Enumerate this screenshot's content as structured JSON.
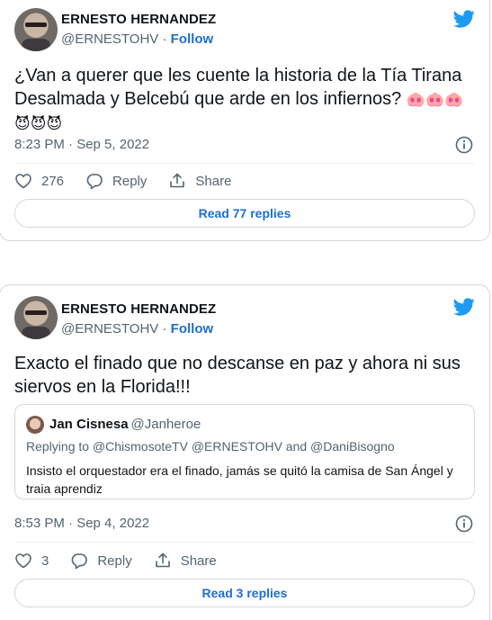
{
  "tweets": [
    {
      "author": {
        "name": "ERNESTO HERNANDEZ",
        "handle": "@ERNESTOHV",
        "separator": "·",
        "follow": "Follow"
      },
      "text": "¿Van a querer que les cuente la historia de la Tía Tirana Desalmada y Belcebú que arde en los infiernos?",
      "emojis": "🐽🐽🐽 😈😈😈",
      "timestamp": "8:23 PM · Sep 5, 2022",
      "likes": "276",
      "reply_label": "Reply",
      "share_label": "Share",
      "read_replies": "Read 77 replies"
    },
    {
      "author": {
        "name": "ERNESTO HERNANDEZ",
        "handle": "@ERNESTOHV",
        "separator": "·",
        "follow": "Follow"
      },
      "text": "Exacto el finado que no descanse en paz y ahora ni sus siervos en la Florida!!!",
      "quote": {
        "name": "Jan Cisnesa",
        "handle": "@Janheroe",
        "replying_to": "Replying to @ChismosoteTV @ERNESTOHV and @DaniBisogno",
        "text": "Insisto el orquestador era el finado, jamás se quitó la camisa de San Ángel y traia aprendiz"
      },
      "timestamp": "8:53 PM · Sep 4, 2022",
      "likes": "3",
      "reply_label": "Reply",
      "share_label": "Share",
      "read_replies": "Read 3 replies"
    }
  ],
  "colors": {
    "twitter_blue": "#1d9bf0",
    "link_blue": "#1d6fd0",
    "muted": "#536471",
    "border": "#cfd9de"
  },
  "icons": [
    "twitter-bird-icon",
    "info-icon",
    "heart-icon",
    "reply-icon",
    "share-icon"
  ]
}
